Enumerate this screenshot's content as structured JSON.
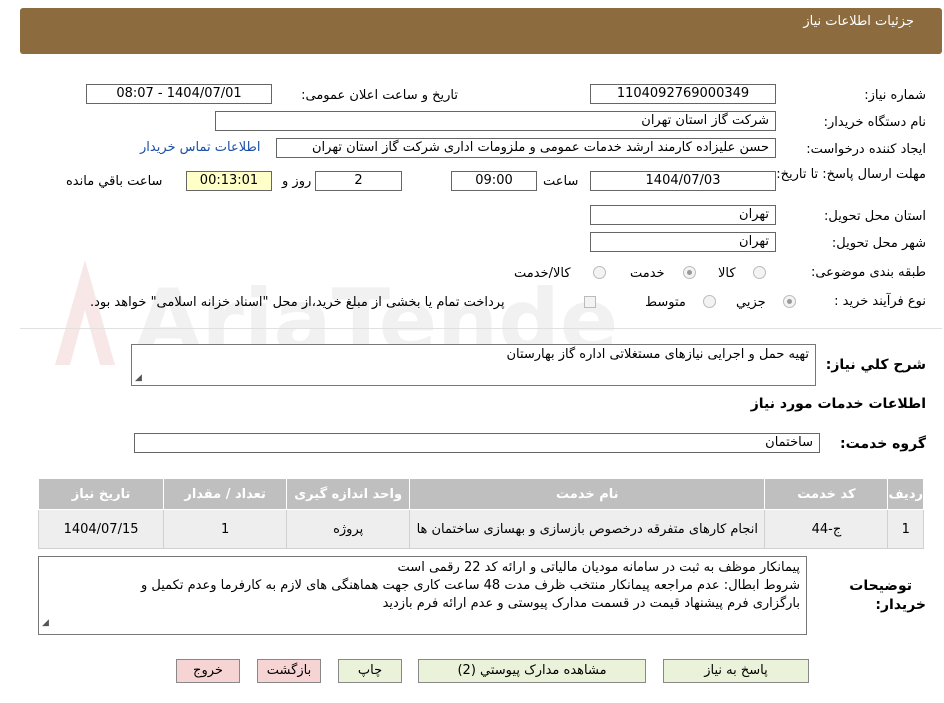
{
  "header": {
    "title": "جزئیات اطلاعات نیاز"
  },
  "watermark": {
    "text": "AriaTender.neT"
  },
  "fields": {
    "need_number_label": "شماره نیاز:",
    "need_number_value": "1104092769000349",
    "announce_label": "تاریخ و ساعت اعلان عمومی:",
    "announce_value": "1404/07/01 - 08:07",
    "buyer_org_label": "نام دستگاه خریدار:",
    "buyer_org_value": "شرکت گاز استان تهران",
    "requester_label": "ایجاد کننده درخواست:",
    "requester_value": "حسن علیزاده کارمند ارشد خدمات عمومی و ملزومات اداری شرکت گاز استان تهران",
    "contact_link": "اطلاعات تماس خریدار",
    "deadline_label": "مهلت ارسال پاسخ: تا تاریخ:",
    "deadline_date": "1404/07/03",
    "time_label": "ساعت",
    "deadline_time": "09:00",
    "days_value": "2",
    "days_label": "روز و",
    "remaining_value": "00:13:01",
    "remaining_label": "ساعت باقي مانده",
    "province_label": "استان محل تحویل:",
    "province_value": "تهران",
    "city_label": "شهر محل تحویل:",
    "city_value": "تهران",
    "category_label": "طبقه بندی موضوعی:",
    "category_options": [
      "کالا",
      "خدمت",
      "کالا/خدمت"
    ],
    "process_label": "نوع فرآیند خرید :",
    "process_options": [
      "جزيي",
      "متوسط"
    ],
    "payment_note": "پرداخت تمام یا بخشی از مبلغ خرید،از محل \"اسناد خزانه اسلامی\" خواهد بود."
  },
  "summary": {
    "label": "شرح کلي نیاز:",
    "value": "تهیه حمل و اجرایی نیازهای مستغلاتی اداره گاز بهارستان"
  },
  "services_section": {
    "title": "اطلاعات خدمات مورد نیاز",
    "group_label": "گروه خدمت:",
    "group_value": "ساختمان"
  },
  "table": {
    "headers": [
      "ردیف",
      "کد خدمت",
      "نام خدمت",
      "واحد اندازه گیری",
      "تعداد / مقدار",
      "تاریخ نیاز"
    ],
    "rows": [
      [
        "1",
        "ج-44",
        "انجام کارهای متفرقه درخصوص بازسازی و بهسازی ساختمان ها",
        "پروژه",
        "1",
        "1404/07/15"
      ]
    ]
  },
  "buyer_notes": {
    "label_line1": "توضیحات",
    "label_line2": "خریدار:",
    "line1": "پیمانکار موظف به ثبت در سامانه مودیان مالیاتی و ارائه کد 22 رقمی است",
    "line2": "شروط ابطال: عدم مراجعه پیمانکار منتخب ظرف مدت 48 ساعت کاری جهت هماهنگی های لازم به کارفرما وعدم تکمیل و",
    "line3": "بارگزاری فرم پیشنهاد قیمت در قسمت مدارک پیوستی و عدم ارائه فرم بازدید"
  },
  "buttons": {
    "reply": "پاسخ به نیاز",
    "attachments": "مشاهده مدارک پیوستي (2)",
    "print": "چاپ",
    "back": "بازگشت",
    "exit": "خروج"
  },
  "colors": {
    "header": "#8c6b3f",
    "link": "#1a4fa8",
    "timer": "#ffffc8",
    "button": "#eaf3d9",
    "button_red": "#f6d4d4"
  }
}
